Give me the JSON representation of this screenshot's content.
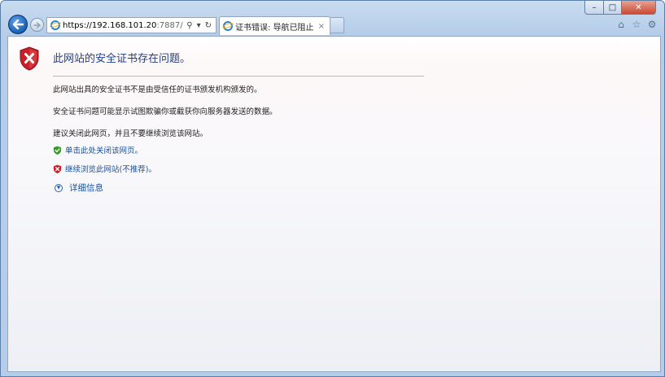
{
  "browser": {
    "url_host": "https://192.168.101.20",
    "url_rest": ":7887/",
    "tab_title": "证书错误: 导航已阻止",
    "tab_close": "×",
    "addr_search_glyph": "⚲",
    "addr_dropdown_glyph": "▾",
    "addr_refresh_glyph": "↻",
    "window_min": "–",
    "window_max": "□",
    "window_close": "✕",
    "home_glyph": "⌂",
    "star_glyph": "☆",
    "gear_glyph": "⚙"
  },
  "page": {
    "heading": "此网站的安全证书存在问题。",
    "para1": "此网站出具的安全证书不是由受信任的证书颁发机构颁发的。",
    "para2": "安全证书问题可能显示试图欺骗你或截获你向服务器发送的数据。",
    "para3": "建议关闭此网页，并且不要继续浏览该网站。",
    "link_close": "单击此处关闭该网页。",
    "link_continue": "继续浏览此网站(不推荐)。",
    "details": "详细信息"
  },
  "colors": {
    "heading": "#1f3f8c",
    "link": "#1a4f9c",
    "shield_red": "#c8202a",
    "check_green": "#3a9a2c"
  }
}
